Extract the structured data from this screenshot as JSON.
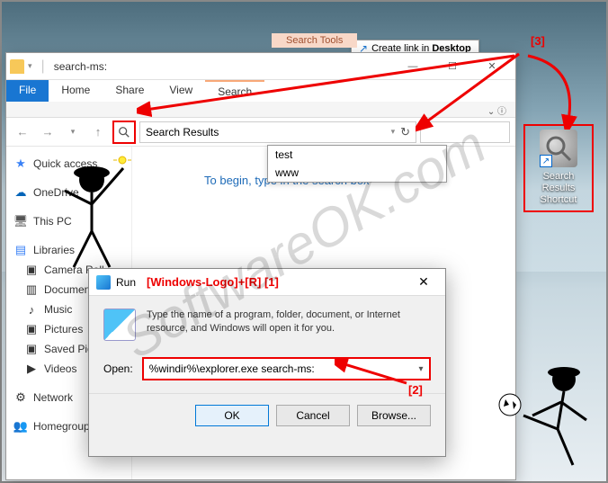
{
  "desktop": {
    "context_tooltip": {
      "icon_label": "↗",
      "text_prefix": "Create link in ",
      "text_bold": "Desktop"
    },
    "shortcut": {
      "label_line1": "Search Results",
      "label_line2": "Shortcut"
    }
  },
  "explorer": {
    "title": "search-ms:",
    "context_tab_label": "Search Tools",
    "tabs": {
      "file": "File",
      "home": "Home",
      "share": "Share",
      "view": "View",
      "search": "Search"
    },
    "address": "Search Results",
    "search_placeholder": "",
    "suggestions": [
      "test",
      "www"
    ],
    "begin_text": "To begin, type in the search box",
    "sidebar": {
      "quick": "Quick access",
      "onedrive": "OneDrive",
      "thispc": "This PC",
      "libraries": "Libraries",
      "lib_items": [
        "Camera Roll",
        "Documents",
        "Music",
        "Pictures",
        "Saved Pictures",
        "Videos"
      ],
      "network": "Network",
      "homegroup": "Homegroup"
    }
  },
  "run": {
    "title": "Run",
    "description": "Type the name of a program, folder, document, or Internet resource, and Windows will open it for you.",
    "open_label": "Open:",
    "input_value": "%windir%\\explorer.exe search-ms:",
    "buttons": {
      "ok": "OK",
      "cancel": "Cancel",
      "browse": "Browse..."
    }
  },
  "annotations": {
    "a1": "[Windows-Logo]+[R] [1]",
    "a2": "[2]",
    "a3": "[3]"
  },
  "watermark": "SoftwareOK.com"
}
